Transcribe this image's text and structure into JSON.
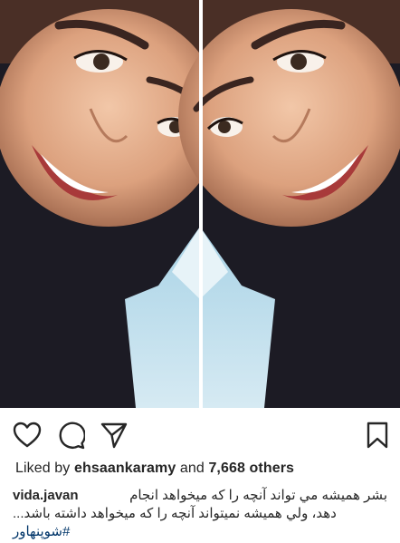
{
  "post": {
    "liked_by_prefix": "Liked by",
    "liked_by_user": "ehsaankaramy",
    "and_word": "and",
    "others_count": "7,668 others",
    "username": "vida.javan",
    "caption_line1": "بشر همیشه مي تواند آنچه را که میخواهد انجام",
    "caption_line2": "دهد، ولي همیشه نمیتواند آنچه را که میخواهد داشته باشد...",
    "hashtag": "#شوپنهاور"
  },
  "actions": {
    "icons": [
      "heart-icon",
      "comment-icon",
      "share-icon",
      "bookmark-icon"
    ]
  },
  "colors": {
    "text": "#262626",
    "hashtag": "#003569",
    "background": "#ffffff"
  }
}
